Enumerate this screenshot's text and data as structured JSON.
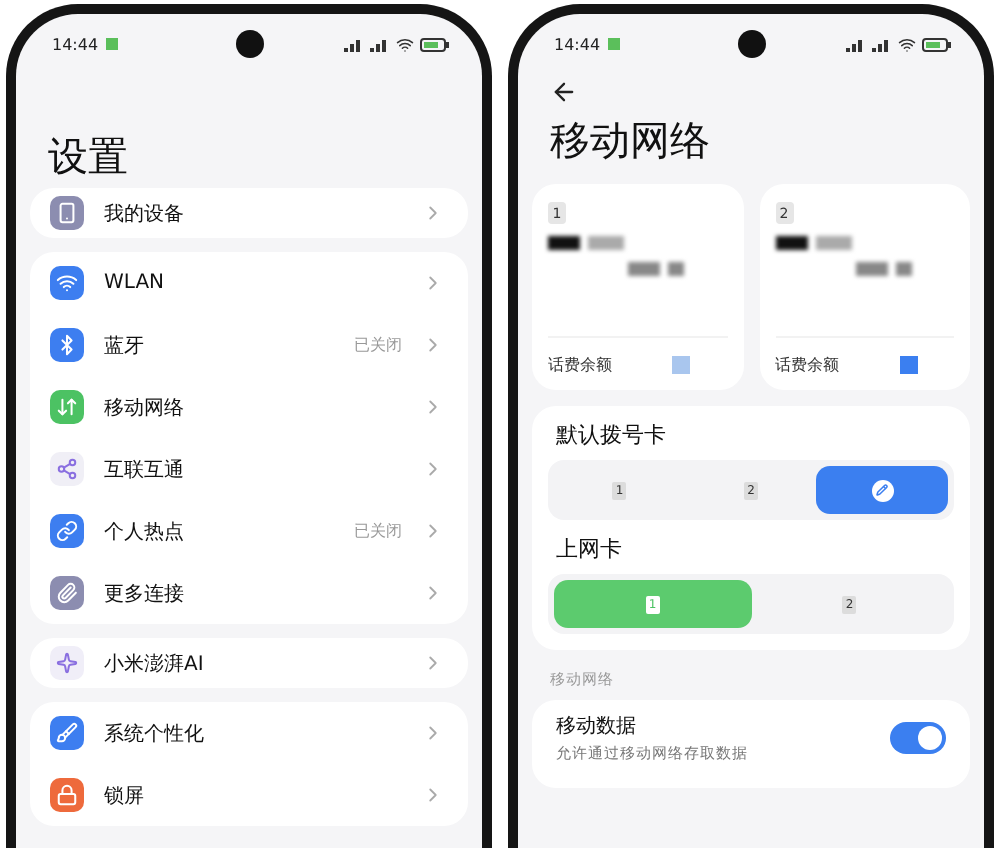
{
  "settings_phone": {
    "status_time": "14:44",
    "title": "设置",
    "groups": [
      {
        "items": [
          {
            "label": "我的设备",
            "color": "#8c8db0"
          }
        ]
      },
      {
        "items": [
          {
            "label": "WLAN",
            "color": "#3d7ef0"
          },
          {
            "label": "蓝牙",
            "value": "已关闭",
            "color": "#3d7ef0"
          },
          {
            "label": "移动网络",
            "color": "#4cc263"
          },
          {
            "label": "互联互通",
            "color": "#f0eff6"
          },
          {
            "label": "个人热点",
            "value": "已关闭",
            "color": "#3d7ef0"
          },
          {
            "label": "更多连接",
            "color": "#8c8db0"
          }
        ]
      },
      {
        "items": [
          {
            "label": "小米澎湃AI",
            "color": "#f0eef8"
          }
        ]
      },
      {
        "items": [
          {
            "label": "系统个性化",
            "color": "#3d7ef0"
          },
          {
            "label": "锁屏",
            "color": "#ee6a3c"
          }
        ]
      }
    ]
  },
  "network_phone": {
    "status_time": "14:44",
    "title": "移动网络",
    "sims": [
      {
        "badge": "1",
        "balance_label": "话费余额",
        "color": "#a9c6ee"
      },
      {
        "badge": "2",
        "balance_label": "话费余额",
        "color": "#3b7ff0"
      }
    ],
    "default_dial": {
      "title": "默认拨号卡",
      "options": [
        {
          "kind": "sim",
          "label": "1",
          "selected": false
        },
        {
          "kind": "sim",
          "label": "2",
          "selected": false
        },
        {
          "kind": "ask",
          "selected": true
        }
      ]
    },
    "data_card": {
      "title": "上网卡",
      "options": [
        {
          "kind": "sim",
          "label": "1",
          "selected": true
        },
        {
          "kind": "sim",
          "label": "2",
          "selected": false
        }
      ]
    },
    "section_label": "移动网络",
    "mobile_data": {
      "title": "移动数据",
      "subtitle": "允许通过移动网络存取数据",
      "on": true
    }
  }
}
